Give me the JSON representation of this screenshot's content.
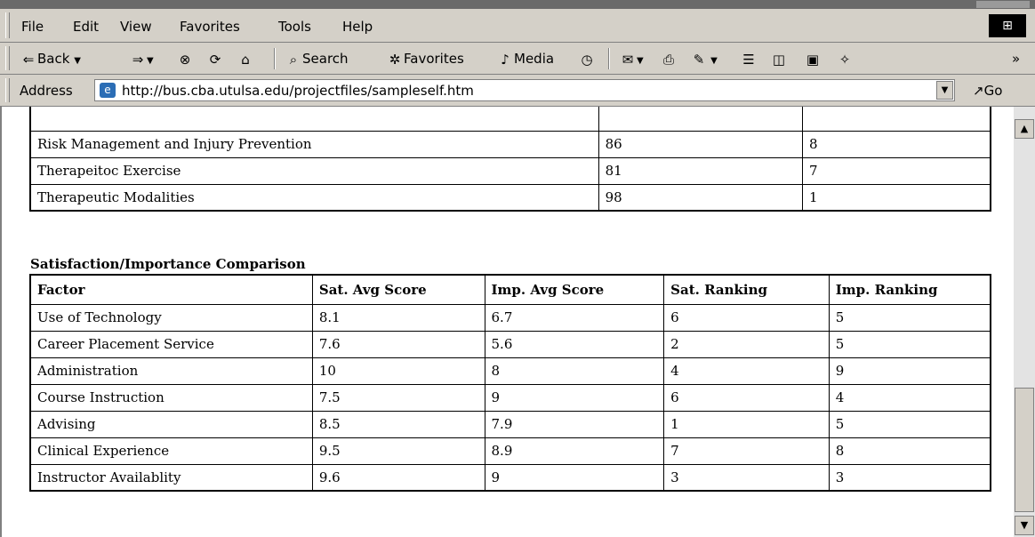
{
  "menubar": {
    "items": [
      "File",
      "Edit",
      "View",
      "Favorites",
      "Tools",
      "Help"
    ]
  },
  "toolbar": {
    "back_label": "Back",
    "search_label": "Search",
    "favorites_label": "Favorites",
    "media_label": "Media"
  },
  "address": {
    "label": "Address",
    "url": "http://bus.cba.utulsa.edu/projectfiles/sampleself.htm",
    "go_label": "Go"
  },
  "table1": {
    "rows": [
      [
        "Risk Management and Injury Prevention",
        "86",
        "8"
      ],
      [
        "Therapeitoc Exercise",
        "81",
        "7"
      ],
      [
        "Therapeutic Modalities",
        "98",
        "1"
      ]
    ]
  },
  "comparison": {
    "title": "Satisfaction/Importance Comparison",
    "headers": [
      "Factor",
      "Sat. Avg Score",
      "Imp. Avg Score",
      "Sat. Ranking",
      "Imp. Ranking"
    ],
    "rows": [
      [
        "Use of Technology",
        "8.1",
        "6.7",
        "6",
        "5"
      ],
      [
        "Career Placement Service",
        "7.6",
        "5.6",
        "2",
        "5"
      ],
      [
        "Administration",
        "10",
        "8",
        "4",
        "9"
      ],
      [
        "Course Instruction",
        "7.5",
        "9",
        "6",
        "4"
      ],
      [
        "Advising",
        "8.5",
        "7.9",
        "1",
        "5"
      ],
      [
        "Clinical Experience",
        "9.5",
        "8.9",
        "7",
        "8"
      ],
      [
        "Instructor Availablity",
        "9.6",
        "9",
        "3",
        "3"
      ]
    ]
  }
}
